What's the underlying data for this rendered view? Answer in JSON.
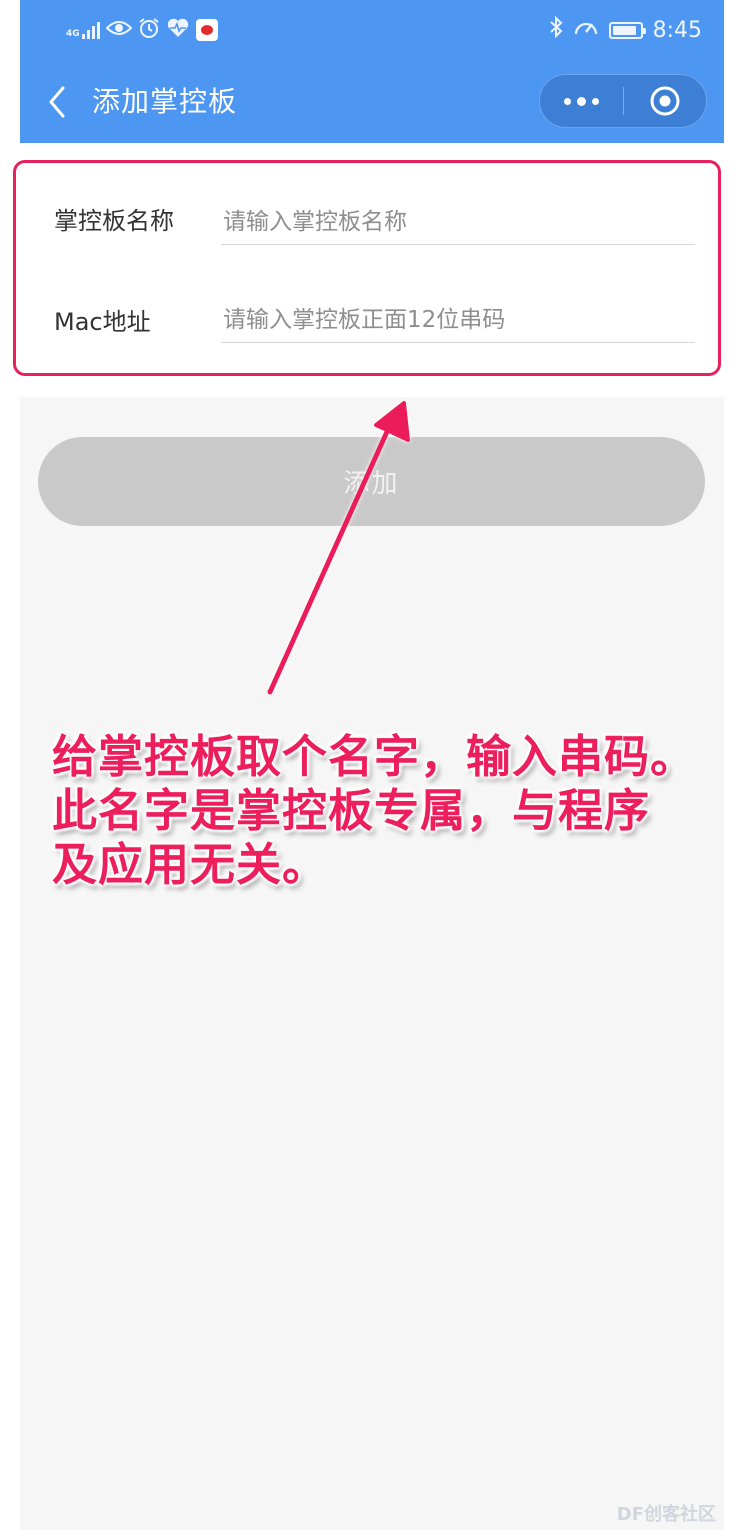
{
  "status_bar": {
    "network": "4G",
    "time": "8:45",
    "battery_level": 0.9,
    "icons": [
      "signal-icon",
      "eye-icon",
      "alarm-icon",
      "heart-rate-icon",
      "weibo-icon",
      "bluetooth-icon",
      "speed-icon",
      "battery-icon"
    ]
  },
  "nav": {
    "title": "添加掌控板",
    "back_icon": "chevron-left-icon",
    "menu_icon": "more-dots-icon",
    "close_icon": "target-icon"
  },
  "form": {
    "name_label": "掌控板名称",
    "name_placeholder": "请输入掌控板名称",
    "mac_label": "Mac地址",
    "mac_placeholder": "请输入掌控板正面12位串码"
  },
  "actions": {
    "add_label": "添加"
  },
  "annotation": {
    "lines": [
      "给掌控板取个名字，输入串码。",
      "此名字是掌控板专属，与程序",
      "及应用无关。"
    ]
  },
  "watermark": "DF创客社区",
  "colors": {
    "nav_blue": "#4d97f2",
    "highlight": "#e8205d",
    "button_disabled": "#c9c9c9"
  }
}
